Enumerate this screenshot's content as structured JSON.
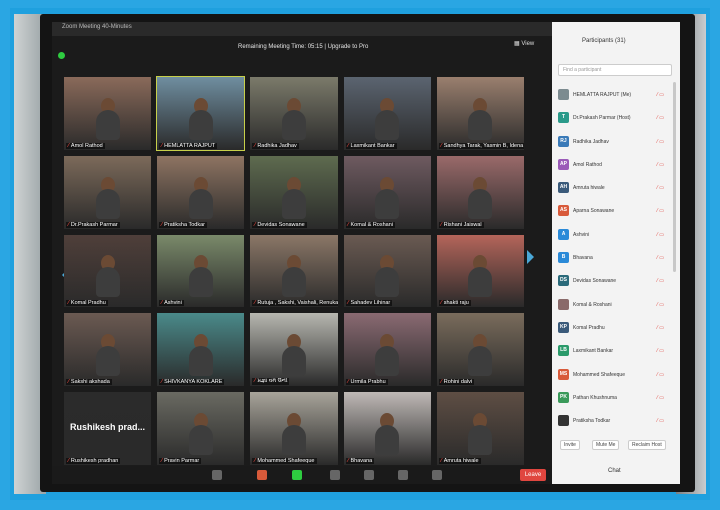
{
  "window": {
    "title": "Zoom Meeting 40-Minutes"
  },
  "banner": {
    "text": "Remaining Meeting Time: 05:15 | Upgrade to Pro"
  },
  "view_label": "View",
  "tiles": [
    {
      "name": "Amol Rathod",
      "color": "#8a6a5a",
      "active": false
    },
    {
      "name": "HEMLATTA RAJPUT",
      "color": "#6f8ea0",
      "active": true
    },
    {
      "name": "Radhika Jadhav",
      "color": "#7b7a6a",
      "active": false
    },
    {
      "name": "Laxmikant Bankar",
      "color": "#5b6470",
      "active": false
    },
    {
      "name": "Sandhya Tarak, Yasmin B, Idena u...",
      "color": "#9a7f6e",
      "active": false
    },
    {
      "name": "Dr.Prakash Parmar",
      "color": "#7c6a5a",
      "active": false
    },
    {
      "name": "Pratiksha Todkar",
      "color": "#8e7462",
      "active": false
    },
    {
      "name": "Devidas Sonawane",
      "color": "#5e6b4f",
      "active": false
    },
    {
      "name": "Komal & Roshani",
      "color": "#6e5a60",
      "active": false
    },
    {
      "name": "Rishani Jaiswal",
      "color": "#9a6a6a",
      "active": false
    },
    {
      "name": "Komal Pradhu",
      "color": "#4f3f3a",
      "active": false
    },
    {
      "name": "Ashvini",
      "color": "#7a8a6a",
      "active": false
    },
    {
      "name": "Rutuja , Sakshi, Vaishali, Renuka",
      "color": "#8b7767",
      "active": false
    },
    {
      "name": "Sahadev Lihinar",
      "color": "#6a5a52",
      "active": false
    },
    {
      "name": "shakti raju",
      "color": "#b4655a",
      "active": false
    },
    {
      "name": "Sakshi akshada",
      "color": "#6b5a52",
      "active": false
    },
    {
      "name": "SHIVKANYA KOKLARE",
      "color": "#4a8a8a",
      "active": false
    },
    {
      "name": "પ્રજ્ઞા વર્મ ઉની",
      "color": "#b7b7b0",
      "active": false
    },
    {
      "name": "Urmila Prabhu",
      "color": "#8a6a72",
      "active": false
    },
    {
      "name": "Rohini dalvi",
      "color": "#7a6c5c",
      "active": false
    },
    {
      "name": "Rushikesh pradhan",
      "color": "#2b2b2b",
      "active": false,
      "big": "Rushikesh prad..."
    },
    {
      "name": "Pravin Parmar",
      "color": "#6a6a62",
      "active": false
    },
    {
      "name": "Mohammed Shafeeque",
      "color": "#a8a49a",
      "active": false
    },
    {
      "name": "Bhavana",
      "color": "#bfb9b6",
      "active": false
    },
    {
      "name": "Amruta hiwale",
      "color": "#5e4e44",
      "active": false
    }
  ],
  "toolbar": {
    "leave": "Leave"
  },
  "participants_panel": {
    "title": "Participants (31)",
    "search_placeholder": "Find a participant",
    "people": [
      {
        "initials": "",
        "name": "HEMLATTA RAJPUT (Me)",
        "color": "#7c8b90"
      },
      {
        "initials": "T",
        "name": "Dr.Prakash Parmar (Host)",
        "color": "#2a9a8a"
      },
      {
        "initials": "RJ",
        "name": "Radhika Jadhav",
        "color": "#3a7ab8"
      },
      {
        "initials": "AP",
        "name": "Amol Rathod",
        "color": "#9a5ab8"
      },
      {
        "initials": "AH",
        "name": "Amruta hiwale",
        "color": "#3a5a7a"
      },
      {
        "initials": "AS",
        "name": "Aparna Sonawane",
        "color": "#d85a3a"
      },
      {
        "initials": "A",
        "name": "Ashvini",
        "color": "#2a8ad8"
      },
      {
        "initials": "B",
        "name": "Bhavana",
        "color": "#2a8ad8"
      },
      {
        "initials": "DS",
        "name": "Devidas Sonawane",
        "color": "#2a6a7a"
      },
      {
        "initials": "",
        "name": "Komal & Roshani",
        "color": "#8a6a6a"
      },
      {
        "initials": "KP",
        "name": "Komal Pradhu",
        "color": "#3a5a7a"
      },
      {
        "initials": "LB",
        "name": "Laxmikant Bankar",
        "color": "#2a9a6a"
      },
      {
        "initials": "MS",
        "name": "Mohammed Shafeeque",
        "color": "#d85a3a"
      },
      {
        "initials": "PK",
        "name": "Pathan Khushnuma",
        "color": "#3a9a5a"
      },
      {
        "initials": "",
        "name": "Pratiksha Todkar",
        "color": "#333333"
      }
    ],
    "buttons": {
      "invite": "Invite",
      "mute_me": "Mute Me",
      "reclaim_host": "Reclaim Host"
    },
    "chat": "Chat"
  }
}
